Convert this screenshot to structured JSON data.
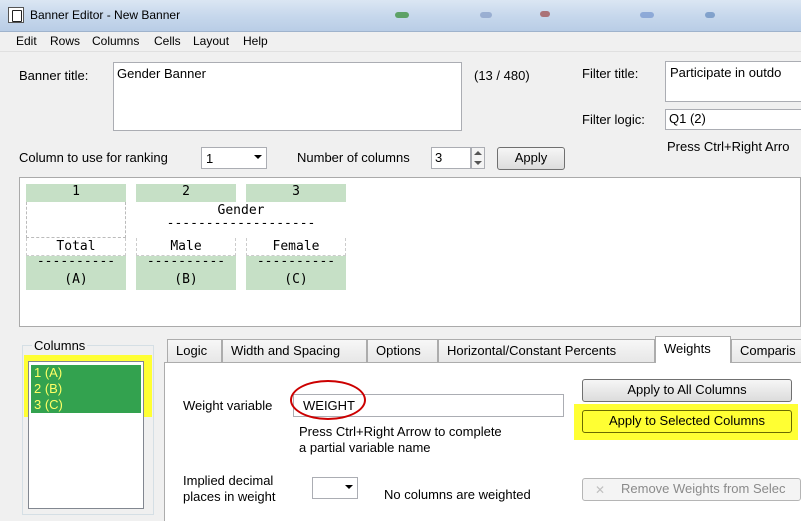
{
  "window": {
    "title": "Banner Editor - New Banner"
  },
  "menu": [
    "Edit",
    "Rows",
    "Columns",
    "Cells",
    "Layout",
    "Help"
  ],
  "banner": {
    "title_label": "Banner title:",
    "title_value": "Gender Banner",
    "char_count": "(13 / 480)",
    "filter_title_label": "Filter title:",
    "filter_title_value": "Participate in outdo",
    "filter_logic_label": "Filter logic:",
    "filter_logic_value": "Q1 (2)",
    "filter_hint": "Press Ctrl+Right Arro"
  },
  "ranking": {
    "label": "Column to use for ranking",
    "value": "1",
    "numcols_label": "Number of columns",
    "numcols_value": "3",
    "apply_label": "Apply"
  },
  "preview": {
    "col_numbers": [
      "1",
      "2",
      "3"
    ],
    "group_header": "Gender",
    "dash_line": "-------------------",
    "col_labels": [
      "Total",
      "Male",
      "Female"
    ],
    "col_dashes": [
      "----------",
      "----------",
      "----------"
    ],
    "col_letters": [
      "(A)",
      "(B)",
      "(C)"
    ]
  },
  "columns_panel": {
    "label": "Columns",
    "items": [
      "1 (A)",
      "2 (B)",
      "3 (C)"
    ]
  },
  "tabs": [
    "Logic",
    "Width and Spacing",
    "Options",
    "Horizontal/Constant Percents",
    "Weights",
    "Comparis"
  ],
  "weights": {
    "var_label": "Weight variable",
    "var_value": "WEIGHT",
    "hint_line1": "Press Ctrl+Right Arrow to complete",
    "hint_line2": "a partial variable name",
    "apply_all": "Apply to All Columns",
    "apply_selected": "Apply to Selected Columns",
    "implied_line1": "Implied decimal",
    "implied_line2": "places in weight",
    "status": "No columns are weighted",
    "remove_label": "Remove Weights from Selec"
  },
  "colors": {
    "highlight": "#ffff33",
    "selection": "#33a24f",
    "preview_green": "#c6e0c6",
    "annotation": "#cc0000"
  }
}
